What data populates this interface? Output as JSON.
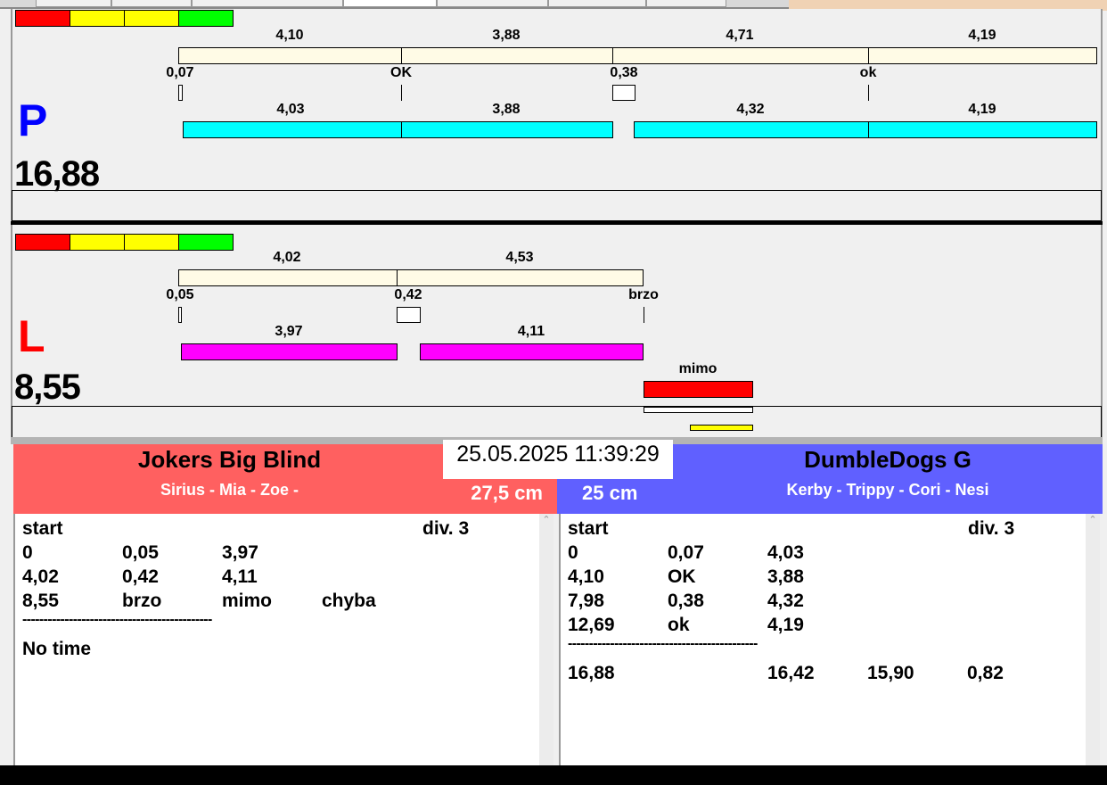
{
  "colors": {
    "red": "#ff0000",
    "yellow": "#ffff00",
    "green": "#00ff00",
    "cream": "#fffbe6",
    "cyan": "#00ffff",
    "magenta": "#ff00ff",
    "team_left": "#ff6060",
    "team_right": "#6060ff"
  },
  "right_lane": {
    "letter": "P",
    "total": "16,88",
    "top_labels": [
      "4,10",
      "3,88",
      "4,71",
      "4,19"
    ],
    "mid_labels": [
      "0,07",
      "OK",
      "0,38",
      "ok"
    ],
    "bottom_labels": [
      "4,03",
      "3,88",
      "4,32",
      "4,19"
    ]
  },
  "left_lane": {
    "letter": "L",
    "total": "8,55",
    "top_labels": [
      "4,02",
      "4,53"
    ],
    "mid_labels": [
      "0,05",
      "0,42",
      "brzo"
    ],
    "bottom_labels": [
      "3,97",
      "4,11"
    ],
    "fault_label": "mimo"
  },
  "datetime": "25.05.2025 11:39:29",
  "team_left": {
    "name": "Jokers Big Blind",
    "dogs": "Sirius - Mia - Zoe -",
    "height": "27,5 cm",
    "header": [
      "start",
      "div.  3"
    ],
    "rows": [
      [
        "0",
        "0,05",
        "3,97",
        ""
      ],
      [
        "4,02",
        "0,42",
        "4,11",
        ""
      ],
      [
        "8,55",
        "brzo",
        "mimo",
        "chyba"
      ]
    ],
    "separator": "---------------------------------------------",
    "result": "No time"
  },
  "team_right": {
    "name": "DumbleDogs G",
    "dogs": "Kerby - Trippy - Cori - Nesi",
    "height": "25 cm",
    "header": [
      "start",
      "div.  3"
    ],
    "rows": [
      [
        "0",
        "0,07",
        "4,03"
      ],
      [
        "4,10",
        "OK",
        "3,88"
      ],
      [
        "7,98",
        "0,38",
        "4,32"
      ],
      [
        "12,69",
        "ok",
        "4,19"
      ]
    ],
    "separator": "---------------------------------------------",
    "result": [
      "16,88",
      "16,42",
      "15,90",
      "0,82"
    ]
  }
}
